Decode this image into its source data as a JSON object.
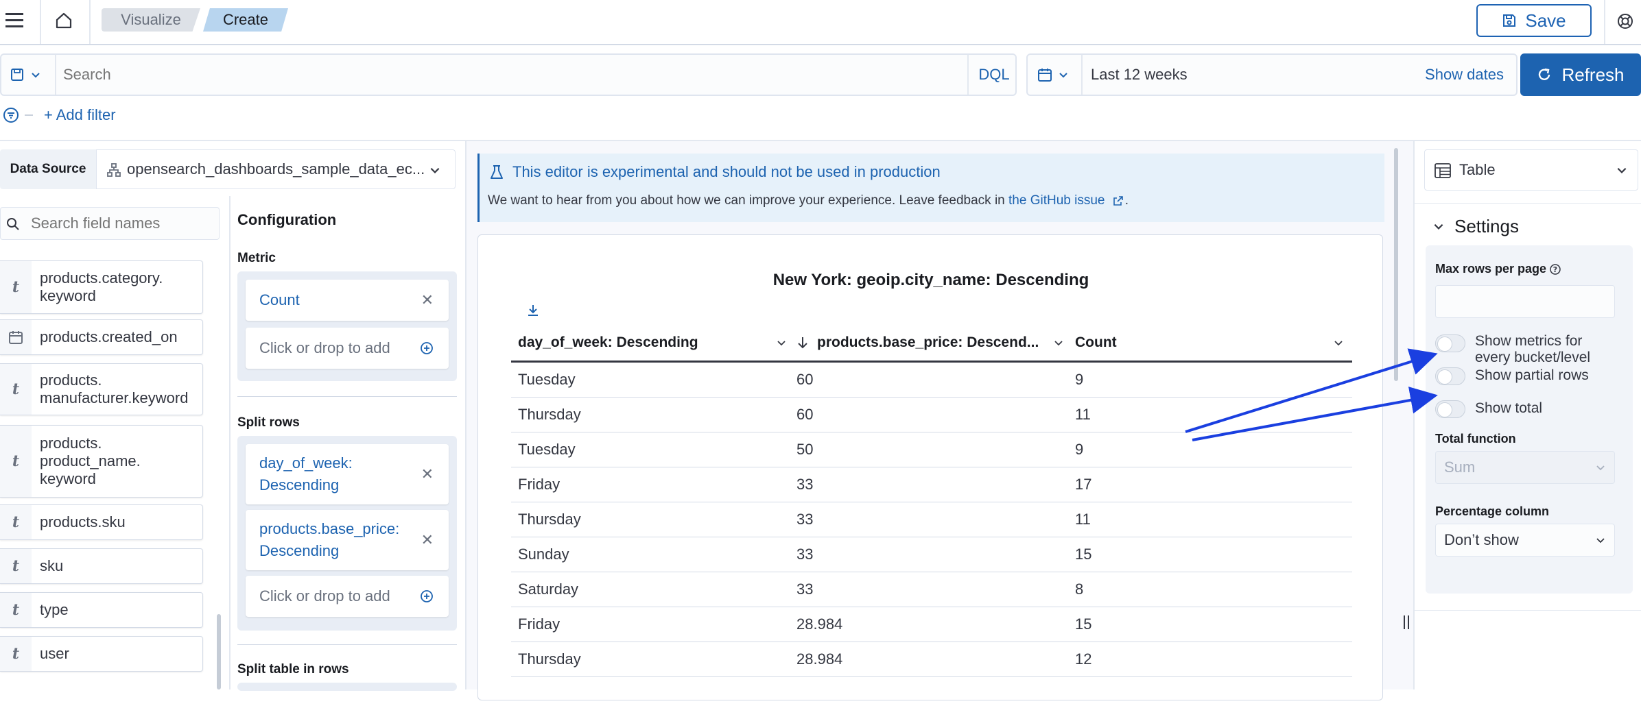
{
  "header": {
    "breadcrumbs": [
      "Visualize",
      "Create"
    ],
    "save_label": "Save"
  },
  "query": {
    "search_placeholder": "Search",
    "language": "DQL",
    "date_range": "Last 12 weeks",
    "show_dates": "Show dates",
    "refresh_label": "Refresh",
    "add_filter": "+ Add filter"
  },
  "left": {
    "data_source_label": "Data Source",
    "data_source_value": "opensearch_dashboards_sample_data_ec...",
    "field_search_placeholder": "Search field names",
    "fields": [
      {
        "type": "t",
        "name": "products.category.\nkeyword"
      },
      {
        "type": "date",
        "name": "products.created_on"
      },
      {
        "type": "t",
        "name": "products.\nmanufacturer.keyword"
      },
      {
        "type": "t",
        "name": "products.\nproduct_name.\nkeyword"
      },
      {
        "type": "t",
        "name": "products.sku"
      },
      {
        "type": "t",
        "name": "sku"
      },
      {
        "type": "t",
        "name": "type"
      },
      {
        "type": "t",
        "name": "user"
      }
    ],
    "config_title": "Configuration",
    "metric_label": "Metric",
    "metric_item": "Count",
    "add_placeholder": "Click or drop to add",
    "split_rows_label": "Split rows",
    "split_rows": [
      "day_of_week:\nDescending",
      "products.base_price:\nDescending"
    ],
    "split_table_label": "Split table in rows"
  },
  "center": {
    "callout_title": "This editor is experimental and should not be used in production",
    "callout_text": "We want to hear from you about how we can improve your experience. Leave feedback in ",
    "callout_link": "the GitHub issue",
    "callout_end": ".",
    "table_title": "New York: geoip.city_name: Descending",
    "columns": [
      "day_of_week: Descending",
      "products.base_price: Descend...",
      "Count"
    ],
    "rows": [
      [
        "Tuesday",
        "60",
        "9"
      ],
      [
        "Thursday",
        "60",
        "11"
      ],
      [
        "Tuesday",
        "50",
        "9"
      ],
      [
        "Friday",
        "33",
        "17"
      ],
      [
        "Thursday",
        "33",
        "11"
      ],
      [
        "Sunday",
        "33",
        "15"
      ],
      [
        "Saturday",
        "33",
        "8"
      ],
      [
        "Friday",
        "28.984",
        "15"
      ],
      [
        "Thursday",
        "28.984",
        "12"
      ]
    ]
  },
  "right": {
    "vis_type": "Table",
    "settings_title": "Settings",
    "max_rows_label": "Max rows per page",
    "max_rows_value": "",
    "options": [
      {
        "label": "Show metrics for\nevery bucket/level",
        "on": false
      },
      {
        "label": "Show partial rows",
        "on": false
      },
      {
        "label": "Show total",
        "on": false
      }
    ],
    "total_function_label": "Total function",
    "total_function_value": "Sum",
    "percentage_label": "Percentage column",
    "percentage_value": "Don’t show"
  },
  "colors": {
    "accent": "#1d63b0",
    "annotation_arrow": "#1a3fe0"
  }
}
